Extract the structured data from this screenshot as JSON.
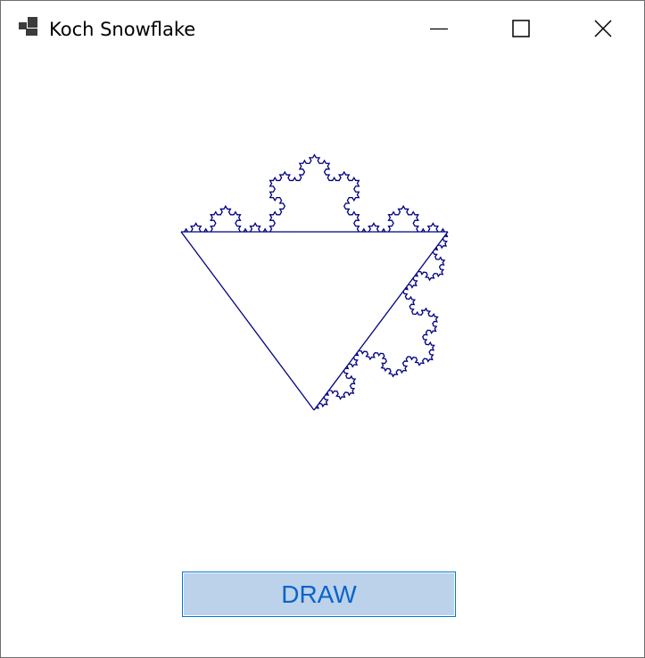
{
  "window": {
    "title": "Koch Snowflake",
    "icon": "app-window-icon"
  },
  "caption_buttons": {
    "minimize_icon": "minimize-icon",
    "maximize_icon": "maximize-icon",
    "close_icon": "close-icon"
  },
  "draw_button": {
    "label": "DRAW"
  },
  "colors": {
    "fractal_stroke": "#000080",
    "button_fill": "#bcd2eb",
    "button_border": "#0078d7",
    "button_text": "#0a64c8",
    "window_border": "#6f6f6f"
  }
}
